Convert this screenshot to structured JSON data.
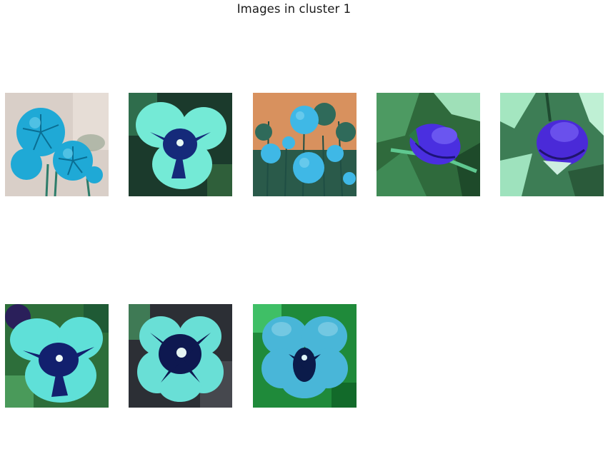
{
  "figure": {
    "title": "Images in cluster 1"
  },
  "images": [
    {
      "subject": "dahlia-cluster",
      "palette": {
        "background": "#d9cfc8",
        "petal": "#1fa9d6",
        "dark": "#0a6e93"
      }
    },
    {
      "subject": "pansy",
      "palette": {
        "background": "#1b3a2c",
        "petal": "#74ead6",
        "dark": "#152a7a"
      }
    },
    {
      "subject": "dahlias-in-garden",
      "palette": {
        "background": "#d8915e",
        "petal": "#3fb8e6",
        "dark": "#1f4e44"
      }
    },
    {
      "subject": "rosebud",
      "palette": {
        "background": "#2f6a3c",
        "petal": "#4a2fe0",
        "dark": "#1d137a"
      }
    },
    {
      "subject": "rosebud",
      "palette": {
        "background": "#3d7d55",
        "petal": "#4a2ad8",
        "dark": "#20146e"
      }
    },
    {
      "subject": "pansy",
      "palette": {
        "background": "#2d6e3a",
        "petal": "#5fe0d8",
        "dark": "#12206e"
      }
    },
    {
      "subject": "pansy",
      "palette": {
        "background": "#2c2f35",
        "petal": "#69dfd6",
        "dark": "#0e1850"
      }
    },
    {
      "subject": "pansy",
      "palette": {
        "background": "#1f8a3a",
        "petal": "#49b6d8",
        "dark": "#0b1b4a"
      }
    }
  ]
}
